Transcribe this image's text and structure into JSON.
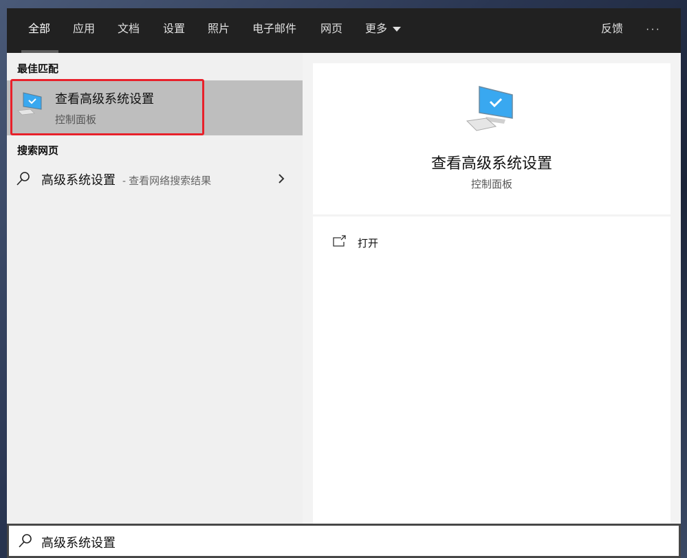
{
  "header": {
    "tabs": [
      "全部",
      "应用",
      "文档",
      "设置",
      "照片",
      "电子邮件",
      "网页",
      "更多"
    ],
    "feedback": "反馈",
    "more_options": "···"
  },
  "left": {
    "best_match_title": "最佳匹配",
    "best_match": {
      "title": "查看高级系统设置",
      "subtitle": "控制面板"
    },
    "web_title": "搜索网页",
    "web_item": {
      "query": "高级系统设置",
      "suffix": "- 查看网络搜索结果"
    }
  },
  "right": {
    "title": "查看高级系统设置",
    "subtitle": "控制面板",
    "actions": [
      "打开"
    ]
  },
  "search": {
    "value": "高级系统设置"
  },
  "colors": {
    "header": "#212121",
    "highlight": "#bebebe",
    "annotation": "#e8202a"
  }
}
